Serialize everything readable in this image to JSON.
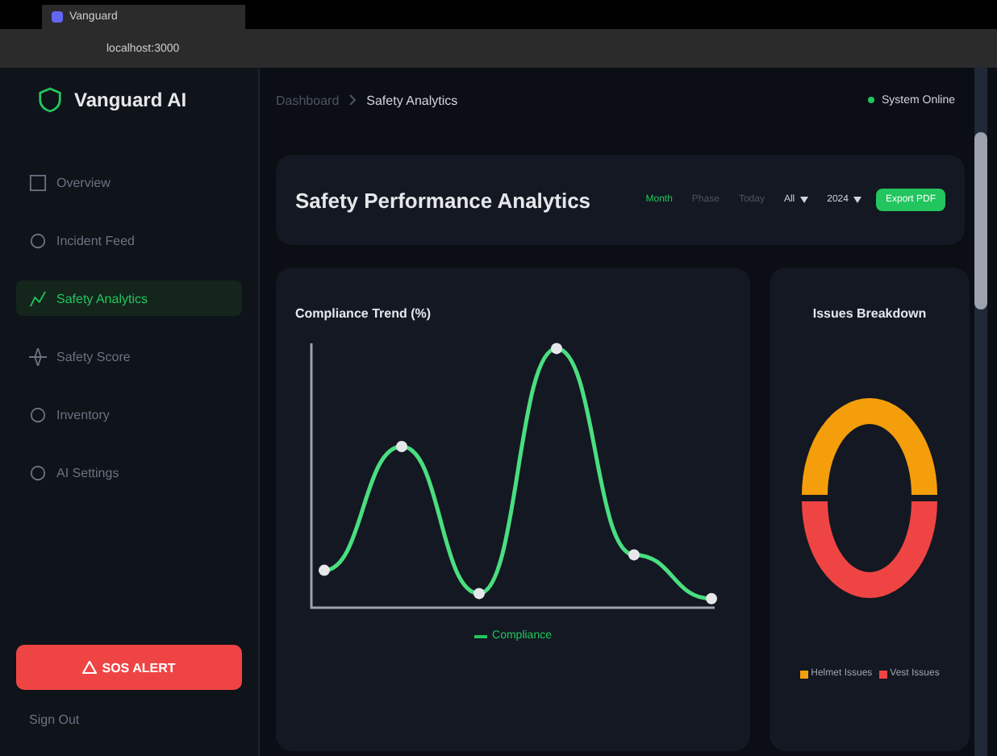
{
  "browser": {
    "tab_title": "Vanguard",
    "url": "localhost:3000"
  },
  "brand": "Vanguard AI",
  "breadcrumb": [
    "Dashboard",
    "Safety Analytics"
  ],
  "status": "System Online",
  "sidebar": {
    "items": [
      {
        "label": "Overview",
        "selected": false
      },
      {
        "label": "Incident Feed",
        "selected": false
      },
      {
        "label": "Safety Analytics",
        "selected": true
      },
      {
        "label": "Safety Score",
        "selected": false
      },
      {
        "label": "Inventory",
        "selected": false
      },
      {
        "label": "AI Settings",
        "selected": false
      }
    ],
    "sos": "SOS ALERT",
    "sign_out": "Sign Out"
  },
  "header": {
    "title": "Safety Performance Analytics",
    "periods": [
      {
        "label": "Month",
        "selected": true
      },
      {
        "label": "Phase",
        "selected": false
      },
      {
        "label": "Today",
        "selected": false
      }
    ],
    "filters": [
      "All",
      "2024"
    ],
    "export": "Export PDF"
  },
  "trend": {
    "title": "Compliance Trend (%)",
    "legend": "Compliance"
  },
  "breakdown": {
    "title": "Issues Breakdown",
    "legend": [
      {
        "label": "Helmet Issues",
        "color": "#f59e0b"
      },
      {
        "label": "Vest Issues",
        "color": "#ef4444"
      }
    ]
  }
}
